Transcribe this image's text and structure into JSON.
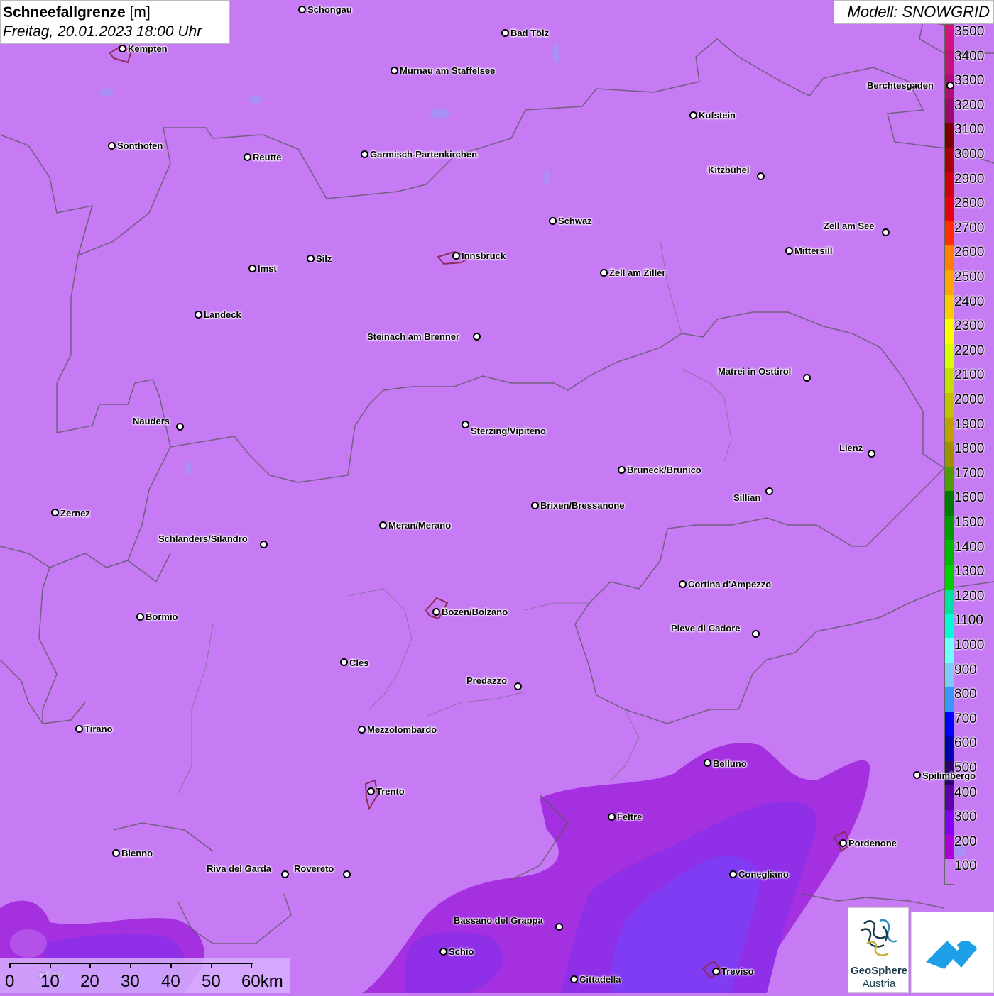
{
  "header": {
    "title_bold": "Schneefallgrenze",
    "title_unit": "[m]",
    "datetime": "Freitag, 20.01.2023 18:00 Uhr"
  },
  "model": {
    "label": "Modell: SNOWGRID"
  },
  "legend": {
    "labels": [
      "3500",
      "3400",
      "3300",
      "3200",
      "3100",
      "3000",
      "2900",
      "2800",
      "2700",
      "2600",
      "2500",
      "2400",
      "2300",
      "2200",
      "2100",
      "2000",
      "1900",
      "1800",
      "1700",
      "1600",
      "1500",
      "1400",
      "1300",
      "1200",
      "1100",
      "1000",
      "900",
      "800",
      "700",
      "600",
      "500",
      "400",
      "300",
      "200",
      "100"
    ],
    "colors": [
      "#d2137e",
      "#c4107a",
      "#b00c78",
      "#9a0a6e",
      "#7a0000",
      "#a8000a",
      "#cc0010",
      "#e80010",
      "#ff2d00",
      "#ff7f00",
      "#ffa600",
      "#ffcb00",
      "#ffff00",
      "#d8ff00",
      "#c8e000",
      "#c4c000",
      "#bfa000",
      "#a09000",
      "#4f9b00",
      "#007a00",
      "#009a00",
      "#00b800",
      "#00d000",
      "#00e0a0",
      "#00ffd8",
      "#70ffff",
      "#80c8ff",
      "#3a96ff",
      "#0000ff",
      "#0000b0",
      "#2a006e",
      "#5a00a8",
      "#8400f0",
      "#b000d8",
      "#c77cf6"
    ]
  },
  "cities": [
    {
      "name": "Schongau"
    },
    {
      "name": "Bad Tölz"
    },
    {
      "name": "Kempten"
    },
    {
      "name": "Murnau am Staffelsee"
    },
    {
      "name": "Berchtesgaden"
    },
    {
      "name": "Kufstein"
    },
    {
      "name": "Sonthofen"
    },
    {
      "name": "Reutte"
    },
    {
      "name": "Garmisch-Partenkirchen"
    },
    {
      "name": "Kitzbühel"
    },
    {
      "name": "Schwaz"
    },
    {
      "name": "Zell am See"
    },
    {
      "name": "Innsbruck"
    },
    {
      "name": "Mittersill"
    },
    {
      "name": "Imst"
    },
    {
      "name": "Silz"
    },
    {
      "name": "Zell am Ziller"
    },
    {
      "name": "Landeck"
    },
    {
      "name": "Steinach am Brenner"
    },
    {
      "name": "Matrei in Osttirol"
    },
    {
      "name": "Nauders"
    },
    {
      "name": "Sterzing/Vipiteno"
    },
    {
      "name": "Lienz"
    },
    {
      "name": "Bruneck/Brunico"
    },
    {
      "name": "Sillian"
    },
    {
      "name": "Zernez"
    },
    {
      "name": "Brixen/Bressanone"
    },
    {
      "name": "Meran/Merano"
    },
    {
      "name": "Schlanders/Silandro"
    },
    {
      "name": "Cortina d'Ampezzo"
    },
    {
      "name": "Bormio"
    },
    {
      "name": "Bozen/Bolzano"
    },
    {
      "name": "Pieve di Cadore"
    },
    {
      "name": "Cles"
    },
    {
      "name": "Predazzo"
    },
    {
      "name": "Tirano"
    },
    {
      "name": "Mezzolombardo"
    },
    {
      "name": "Belluno"
    },
    {
      "name": "Spilimbergo"
    },
    {
      "name": "Trento"
    },
    {
      "name": "Feltre"
    },
    {
      "name": "Pordenone"
    },
    {
      "name": "Bienno"
    },
    {
      "name": "Riva del Garda"
    },
    {
      "name": "Rovereto"
    },
    {
      "name": "Conegliano"
    },
    {
      "name": "Bassano del Grappa"
    },
    {
      "name": "Schio"
    },
    {
      "name": "Treviso"
    },
    {
      "name": "Cittadella"
    },
    {
      "name": "Iseo"
    }
  ],
  "scalebar": {
    "labels": [
      "0",
      "10",
      "20",
      "30",
      "40",
      "50",
      "60km"
    ]
  },
  "logo": {
    "name": "GeoSphere",
    "sub": "Austria"
  }
}
